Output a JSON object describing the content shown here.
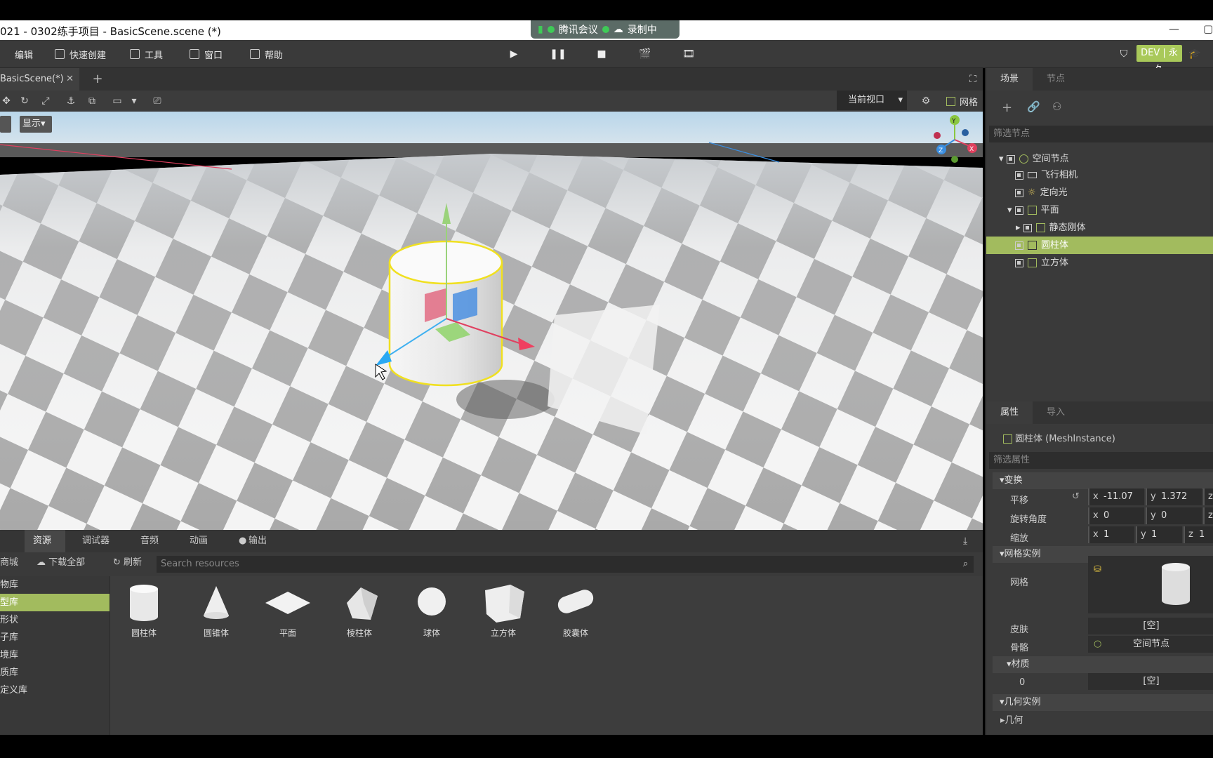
{
  "title": "021 - 0302练手项目 - BasicScene.scene (*)",
  "meeting": {
    "app": "腾讯会议",
    "rec": "录制中"
  },
  "menu": [
    "编辑",
    "快速创建",
    "工具",
    "窗口",
    "帮助"
  ],
  "dev": "DEV | 永久",
  "scene_tab": "BasicScene(*)",
  "viewport": {
    "view": "当前视口",
    "grid": "网格",
    "show": "显示"
  },
  "bottom": {
    "tabs": [
      "资源",
      "调试器",
      "音频",
      "动画",
      "输出"
    ],
    "mall": "商城",
    "download": "下载全部",
    "refresh": "刷新",
    "search_ph": "Search resources",
    "side": [
      "物库",
      "型库",
      "形状",
      "子库",
      "境库",
      "质库",
      "定义库"
    ],
    "assets": [
      "圆柱体",
      "圆锥体",
      "平面",
      "棱柱体",
      "球体",
      "立方体",
      "胶囊体"
    ]
  },
  "right": {
    "tabs": [
      "场景",
      "节点"
    ],
    "filter": "筛选节点",
    "nodes": [
      "空间节点",
      "飞行相机",
      "定向光",
      "平面",
      "静态刚体",
      "圆柱体",
      "立方体"
    ],
    "ptabs": [
      "属性",
      "导入"
    ],
    "selected": "圆柱体 (MeshInstance)",
    "pfilter": "筛选属性",
    "transform": "变换",
    "translate": "平移",
    "tx": "-11.07",
    "ty": "1.372",
    "rotate": "旋转角度",
    "rx": "0",
    "ry": "0",
    "scale": "缩放",
    "sx": "1",
    "sy": "1",
    "sz": "1",
    "meshinst": "网格实例",
    "mesh": "网格",
    "skin": "皮肤",
    "skin_v": "[空]",
    "skeleton": "骨骼",
    "skeleton_v": "空间节点",
    "material": "材质",
    "mat0": "0",
    "mat0_v": "[空]",
    "geominst": "几何实例",
    "geom": "几何"
  },
  "colors": {
    "accent": "#a2bb5e",
    "badge": "#a9c95a"
  }
}
